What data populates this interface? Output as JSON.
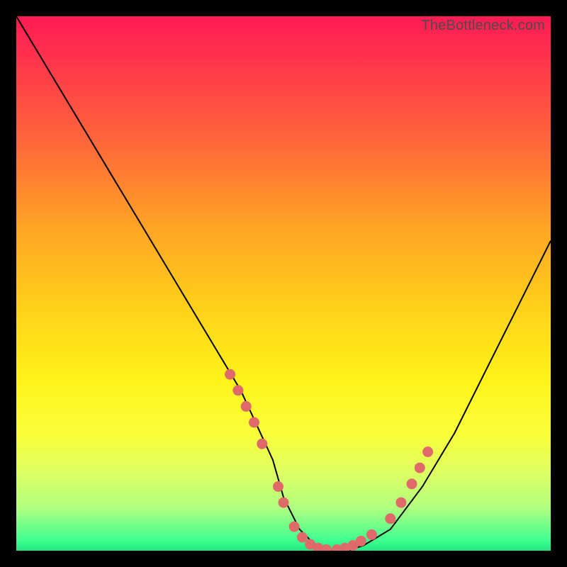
{
  "watermark": "TheBottleneck.com",
  "chart_data": {
    "type": "line",
    "title": "",
    "xlabel": "",
    "ylabel": "",
    "xlim": [
      0,
      100
    ],
    "ylim": [
      0,
      100
    ],
    "grid": false,
    "series": [
      {
        "name": "curve",
        "color": "#000000",
        "x": [
          0,
          6,
          12,
          18,
          24,
          30,
          36,
          42,
          48,
          50,
          53,
          56,
          59,
          62,
          65,
          70,
          76,
          82,
          88,
          94,
          100
        ],
        "y": [
          100,
          90,
          80,
          70,
          60,
          50,
          40,
          30,
          17,
          10,
          4,
          1,
          0,
          0,
          1,
          4,
          12,
          22,
          34,
          46,
          58
        ]
      }
    ],
    "highlight_points": {
      "color": "#e06a6a",
      "radius_pct": 1.0,
      "points": [
        {
          "x": 40,
          "y": 33
        },
        {
          "x": 41.5,
          "y": 30
        },
        {
          "x": 43,
          "y": 27
        },
        {
          "x": 44.5,
          "y": 24
        },
        {
          "x": 46,
          "y": 20
        },
        {
          "x": 49,
          "y": 12
        },
        {
          "x": 50,
          "y": 9
        },
        {
          "x": 52,
          "y": 4.5
        },
        {
          "x": 53.5,
          "y": 2.5
        },
        {
          "x": 55,
          "y": 1.2
        },
        {
          "x": 56.5,
          "y": 0.5
        },
        {
          "x": 58,
          "y": 0.2
        },
        {
          "x": 60,
          "y": 0.2
        },
        {
          "x": 61.5,
          "y": 0.5
        },
        {
          "x": 63,
          "y": 1.0
        },
        {
          "x": 64.5,
          "y": 1.8
        },
        {
          "x": 66.5,
          "y": 3.0
        },
        {
          "x": 70,
          "y": 6.0
        },
        {
          "x": 72,
          "y": 9.0
        },
        {
          "x": 74,
          "y": 12.5
        },
        {
          "x": 75.5,
          "y": 15.5
        },
        {
          "x": 77,
          "y": 18.5
        }
      ]
    }
  }
}
